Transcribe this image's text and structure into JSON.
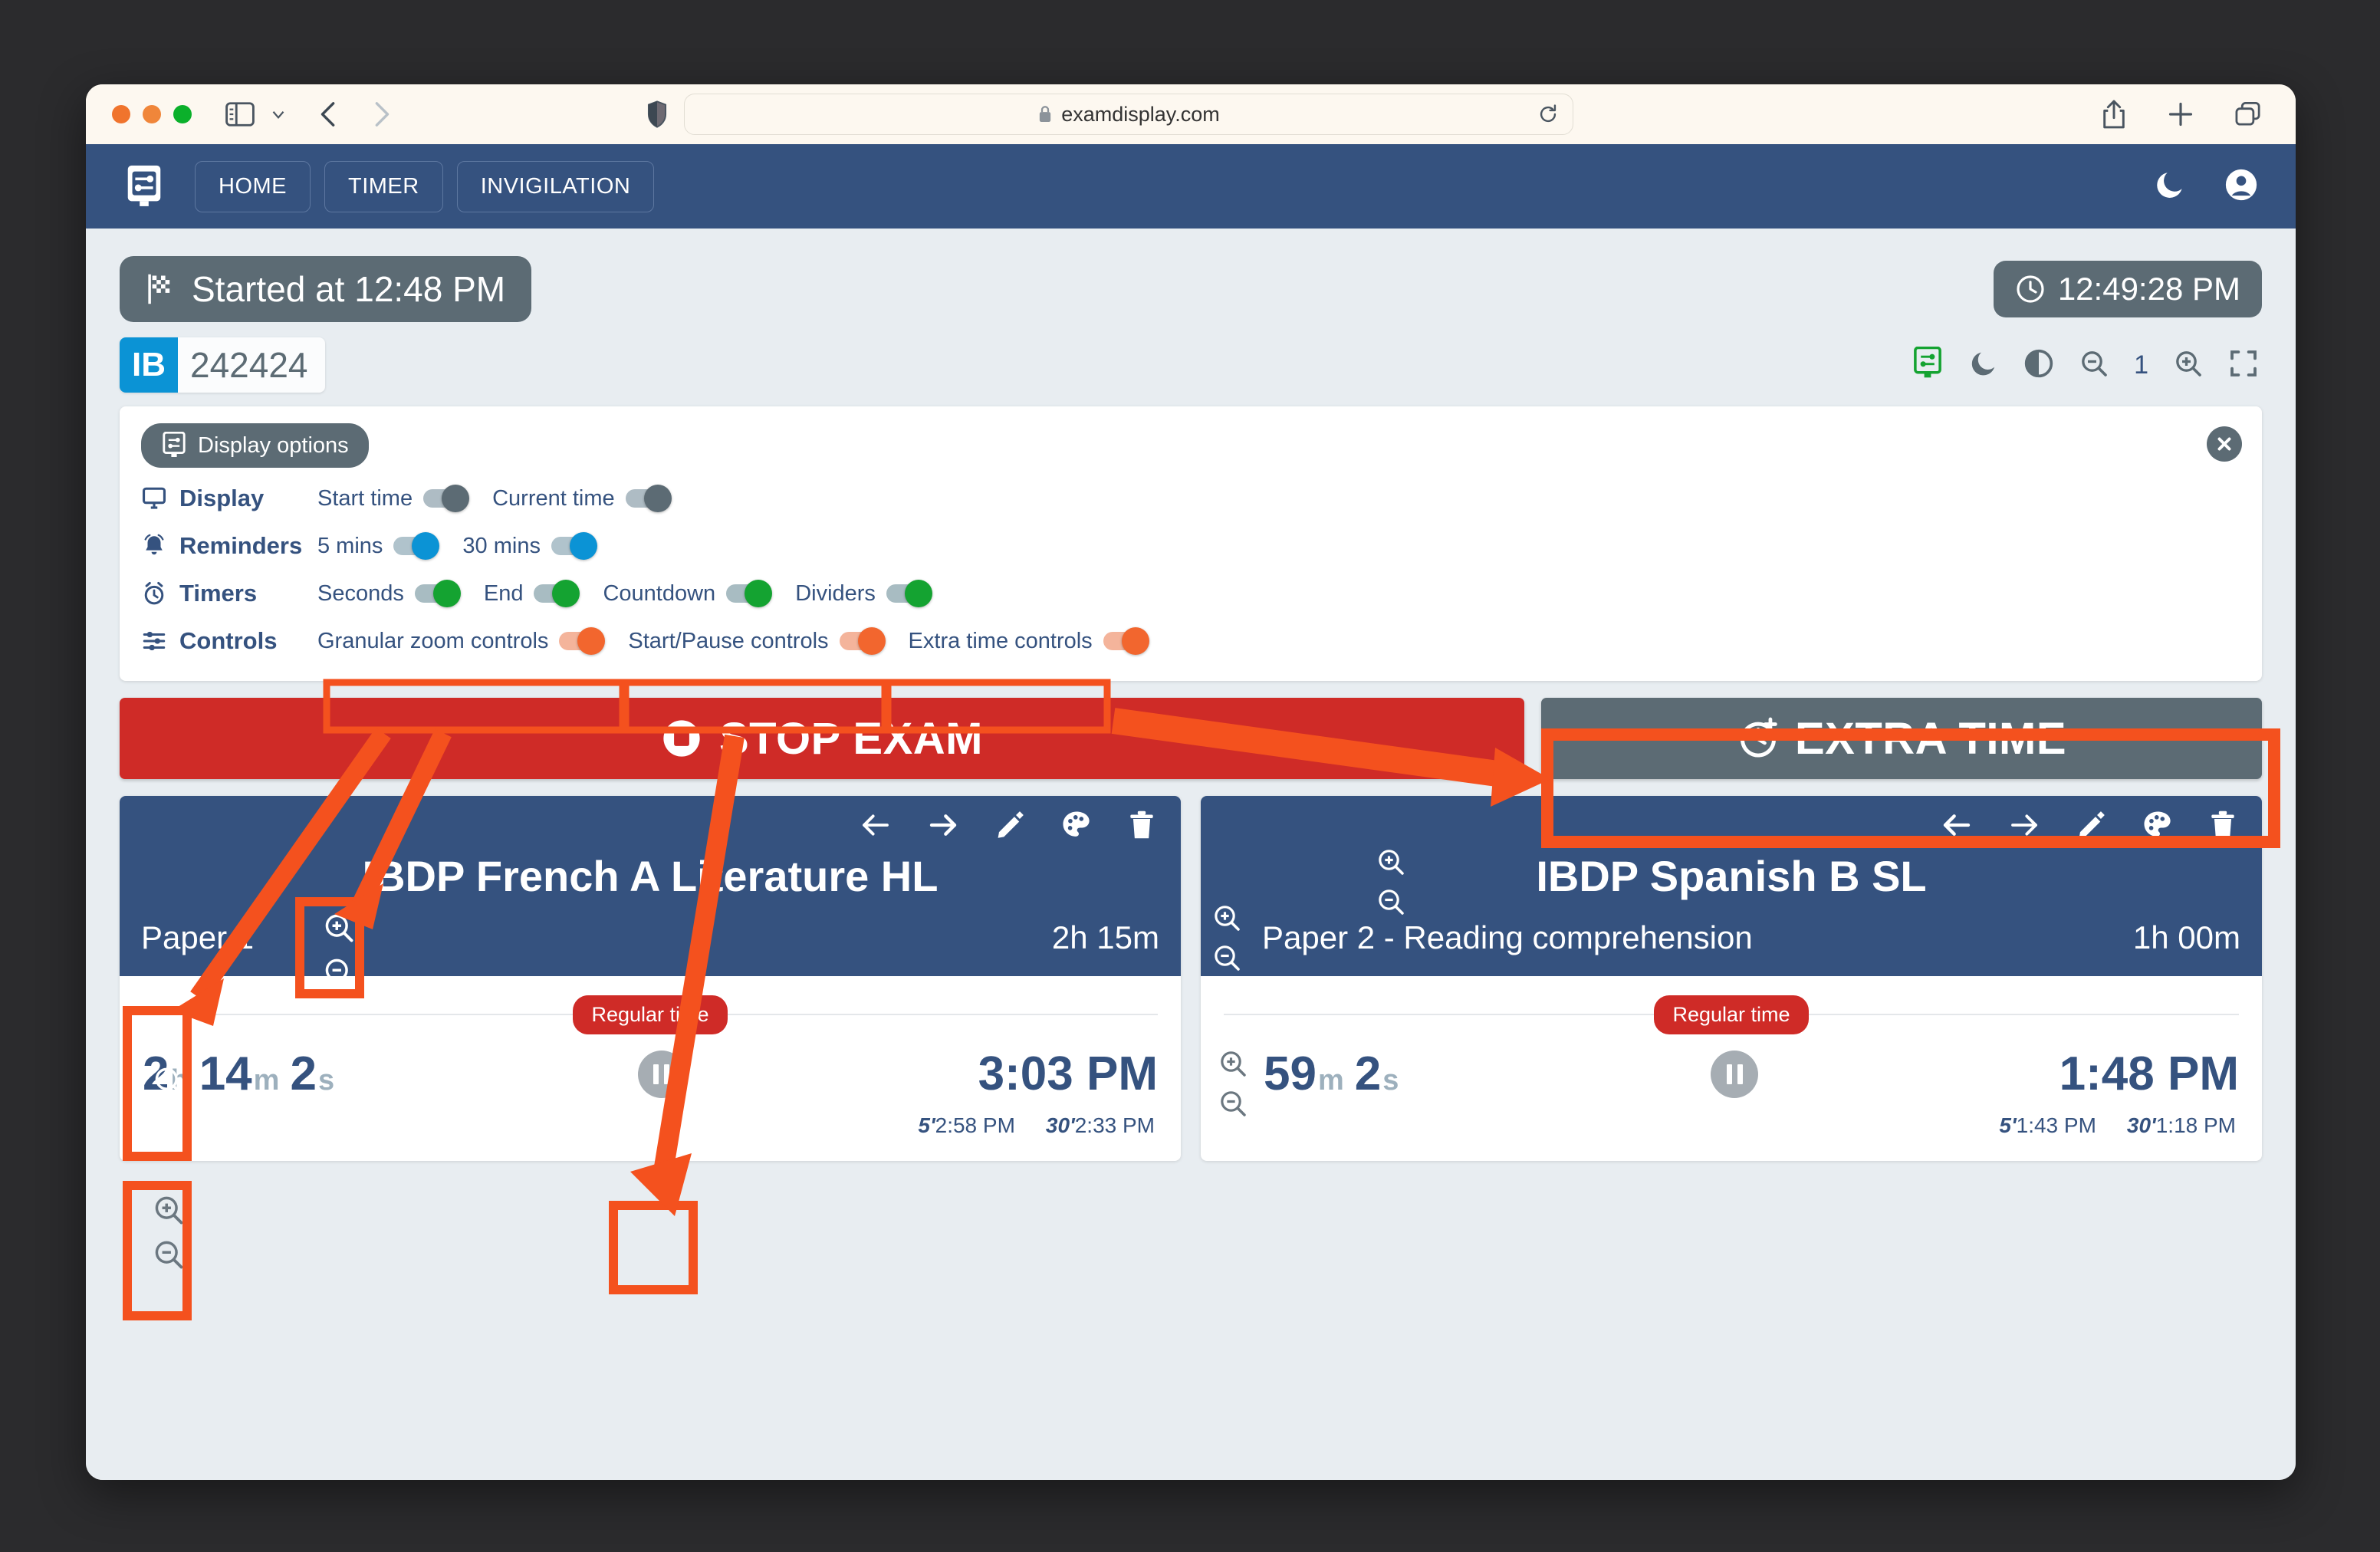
{
  "browser": {
    "url": "examdisplay.com",
    "lock_icon": "lock-icon",
    "traffic_lights": [
      "close",
      "minimize",
      "maximize"
    ],
    "buttons": {
      "sidebar": "sidebar-toggle-icon",
      "sidebar_chevron": "chevron-down-icon",
      "back": "back-arrow-icon",
      "forward": "forward-arrow-icon",
      "shield": "shield-icon",
      "reload": "reload-icon",
      "share": "share-icon",
      "new_tab": "plus-icon",
      "tabs": "tabs-icon"
    }
  },
  "navbar": {
    "brand_icon": "display-settings-icon",
    "tabs": [
      {
        "label": "HOME"
      },
      {
        "label": "TIMER"
      },
      {
        "label": "INVIGILATION"
      }
    ],
    "right_icons": [
      {
        "name": "moon-icon"
      },
      {
        "name": "account-icon"
      }
    ]
  },
  "status": {
    "started_label": "Started at 12:48 PM",
    "started_icon": "checkered-flag-icon",
    "current_time": "12:49:28 PM",
    "clock_icon": "clock-icon"
  },
  "session": {
    "code": "IB",
    "number": "242424",
    "code_color": "#0b93d5"
  },
  "viewer_controls": {
    "items": [
      {
        "name": "display-options-icon",
        "color": "#14a331"
      },
      {
        "name": "moon-icon",
        "color": "#5c6b74"
      },
      {
        "name": "contrast-icon",
        "color": "#5c6b74"
      },
      {
        "name": "zoom-out-icon",
        "color": "#5c6b74"
      },
      {
        "name": "zoom-in-icon",
        "color": "#5c6b74"
      },
      {
        "name": "fullscreen-icon",
        "color": "#5c6b74"
      }
    ],
    "zoom_level": "1"
  },
  "display_options": {
    "panel_title": "Display options",
    "panel_icon": "display-settings-icon",
    "close_icon": "close-icon",
    "rows": [
      {
        "label": "Display",
        "icon": "monitor-icon",
        "items": [
          {
            "label": "Start time",
            "state": "on",
            "color": "gray"
          },
          {
            "label": "Current time",
            "state": "on",
            "color": "gray"
          }
        ]
      },
      {
        "label": "Reminders",
        "icon": "bell-icon",
        "items": [
          {
            "label": "5 mins",
            "state": "on",
            "color": "blue"
          },
          {
            "label": "30 mins",
            "state": "on",
            "color": "blue"
          }
        ]
      },
      {
        "label": "Timers",
        "icon": "alarm-clock-icon",
        "items": [
          {
            "label": "Seconds",
            "state": "on",
            "color": "green"
          },
          {
            "label": "End",
            "state": "on",
            "color": "green"
          },
          {
            "label": "Countdown",
            "state": "on",
            "color": "green"
          },
          {
            "label": "Dividers",
            "state": "on",
            "color": "green"
          }
        ]
      },
      {
        "label": "Controls",
        "icon": "sliders-icon",
        "items": [
          {
            "label": "Granular zoom controls",
            "state": "on",
            "color": "orange"
          },
          {
            "label": "Start/Pause controls",
            "state": "on",
            "color": "orange"
          },
          {
            "label": "Extra time controls",
            "state": "on",
            "color": "orange"
          }
        ]
      }
    ]
  },
  "actions": {
    "stop_exam": {
      "label": "STOP EXAM",
      "icon": "stop-circle-icon",
      "color": "#cf2b27"
    },
    "extra_time": {
      "label": "EXTRA TIME",
      "icon": "extra-time-icon",
      "color": "#5c6b74"
    }
  },
  "cards": [
    {
      "title": "IBDP French A Literature HL",
      "paper": "Paper 1",
      "duration": "2h 15m",
      "time_pill": "Regular time",
      "remaining": [
        {
          "value": "2",
          "unit": "h"
        },
        {
          "value": "14",
          "unit": "m"
        },
        {
          "value": "2",
          "unit": "s"
        }
      ],
      "end_time": "3:03 PM",
      "pause_icon": "pause-icon",
      "reminders": [
        {
          "mark": "5'",
          "time": "2:58 PM"
        },
        {
          "mark": "30'",
          "time": "2:33 PM"
        }
      ],
      "head_icons": [
        "left-arrow-icon",
        "right-arrow-icon",
        "pencil-icon",
        "palette-icon",
        "trash-icon"
      ]
    },
    {
      "title": "IBDP Spanish B SL",
      "paper": "Paper 2 - Reading comprehension",
      "duration": "1h 00m",
      "time_pill": "Regular time",
      "remaining": [
        {
          "value": "59",
          "unit": "m"
        },
        {
          "value": "2",
          "unit": "s"
        }
      ],
      "end_time": "1:48 PM",
      "pause_icon": "pause-icon",
      "reminders": [
        {
          "mark": "5'",
          "time": "1:43 PM"
        },
        {
          "mark": "30'",
          "time": "1:18 PM"
        }
      ],
      "head_icons": [
        "left-arrow-icon",
        "right-arrow-icon",
        "pencil-icon",
        "palette-icon",
        "trash-icon"
      ]
    }
  ],
  "annotation": {
    "color": "#f4511e",
    "highlight_boxes": [
      "granular-zoom-controls-toggle",
      "start-pause-controls-toggle",
      "extra-time-controls-toggle",
      "extra-time-button",
      "card1-title-zoom-pair",
      "card1-paper-zoom-pair",
      "card1-pause-button"
    ]
  }
}
